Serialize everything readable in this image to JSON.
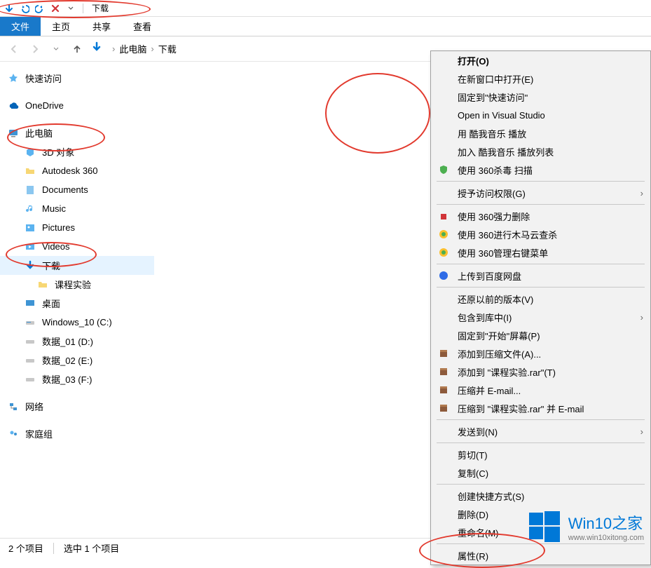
{
  "window": {
    "title": "下载"
  },
  "ribbon": {
    "file": "文件",
    "home": "主页",
    "share": "共享",
    "view": "查看"
  },
  "breadcrumb": {
    "pc": "此电脑",
    "dl": "下载"
  },
  "sidebar": {
    "quick": "快速访问",
    "onedrive": "OneDrive",
    "pc": "此电脑",
    "obj3d": "3D 对象",
    "autodesk": "Autodesk 360",
    "documents": "Documents",
    "music": "Music",
    "pictures": "Pictures",
    "videos": "Videos",
    "downloads": "下载",
    "exp_folder": "课程实验",
    "desktop": "桌面",
    "win10": "Windows_10 (C:)",
    "d01": "数据_01 (D:)",
    "d02": "数据_02 (E:)",
    "d03": "数据_03 (F:)",
    "network": "网络",
    "homegroup": "家庭组"
  },
  "folder": {
    "name": "课程实验"
  },
  "status": {
    "items": "2 个项目",
    "selected": "选中 1 个项目"
  },
  "ctx": {
    "open": "打开(O)",
    "new_window": "在新窗口中打开(E)",
    "pin_quick": "固定到\"快速访问\"",
    "open_vs": "Open in Visual Studio",
    "kugou_play": "用 酷我音乐 播放",
    "kugou_add": "加入 酷我音乐 播放列表",
    "scan_360": "使用 360杀毒 扫描",
    "grant": "授予访问权限(G)",
    "del_360": "使用 360强力删除",
    "trojan": "使用 360进行木马云查杀",
    "manage_360": "使用 360管理右键菜单",
    "baidu": "上传到百度网盘",
    "restore": "还原以前的版本(V)",
    "library": "包含到库中(I)",
    "pin_start": "固定到\"开始\"屏幕(P)",
    "rar_add": "添加到压缩文件(A)...",
    "rar_add_to": "添加到 \"课程实验.rar\"(T)",
    "rar_email": "压缩并 E-mail...",
    "rar_email_to": "压缩到 \"课程实验.rar\" 并 E-mail",
    "send_to": "发送到(N)",
    "cut": "剪切(T)",
    "copy": "复制(C)",
    "shortcut": "创建快捷方式(S)",
    "delete": "删除(D)",
    "rename": "重命名(M)",
    "properties": "属性(R)"
  },
  "watermark": {
    "main": "Win10之家",
    "sub": "www.win10xitong.com"
  }
}
